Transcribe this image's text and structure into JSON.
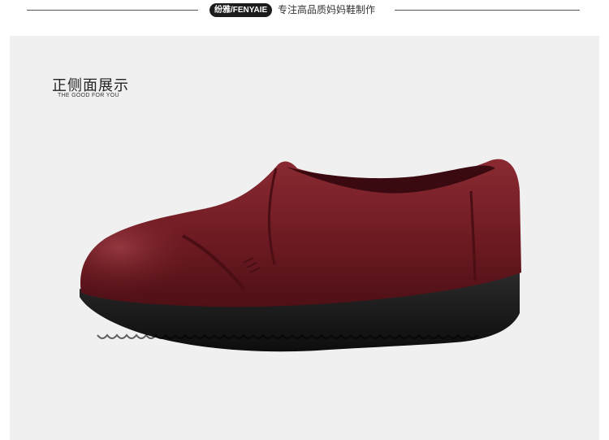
{
  "header": {
    "brand": "纷雅/FENYAIE",
    "tagline": "专注高品质妈妈鞋制作"
  },
  "section": {
    "title": "正侧面展示",
    "subtitle": "THE GOOD FOR YOU"
  },
  "product": {
    "image_name": "burgundy-leather-slip-on-shoe",
    "colors": {
      "leather": "#6e1a22",
      "sole": "#141414",
      "background": "#f0f0f0"
    }
  }
}
